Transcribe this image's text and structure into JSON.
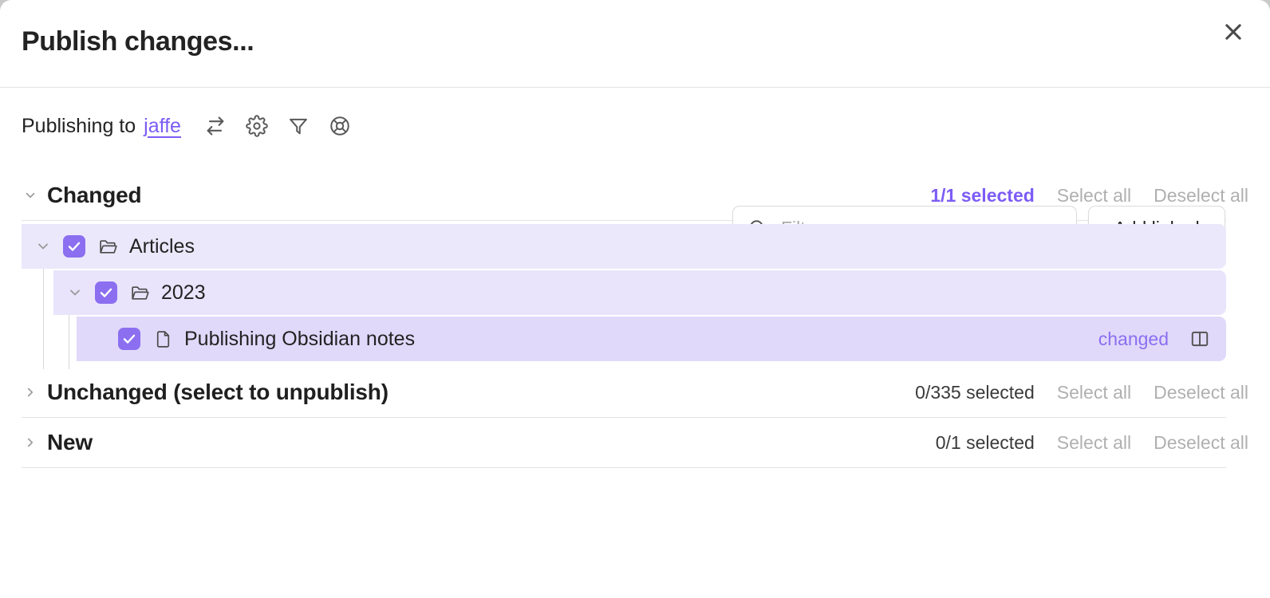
{
  "window": {
    "title": "Publish changes...",
    "close_icon": "close-icon"
  },
  "toolbar": {
    "publishing_label": "Publishing to",
    "target": "jaffe",
    "icons": [
      {
        "name": "swap-arrows-icon",
        "title": "Switch site"
      },
      {
        "name": "gear-icon",
        "title": "Settings"
      },
      {
        "name": "filter-funnel-icon",
        "title": "Filter"
      },
      {
        "name": "lifebuoy-icon",
        "title": "Help"
      }
    ],
    "filter": {
      "icon": "search-icon",
      "placeholder": "Filter...",
      "value": ""
    },
    "add_linked_label": "Add linked"
  },
  "sections": [
    {
      "id": "changed",
      "title": "Changed",
      "expanded": true,
      "chevron": "chevron-down-icon",
      "selected_text": "1/1 selected",
      "selected_highlight": true,
      "select_all_label": "Select all",
      "deselect_all_label": "Deselect all"
    },
    {
      "id": "unchanged",
      "title": "Unchanged (select to unpublish)",
      "expanded": false,
      "chevron": "chevron-right-icon",
      "selected_text": "0/335 selected",
      "selected_highlight": false,
      "select_all_label": "Select all",
      "deselect_all_label": "Deselect all"
    },
    {
      "id": "new",
      "title": "New",
      "expanded": false,
      "chevron": "chevron-right-icon",
      "selected_text": "0/1 selected",
      "selected_highlight": false,
      "select_all_label": "Select all",
      "deselect_all_label": "Deselect all"
    }
  ],
  "tree": [
    {
      "level": 0,
      "kind": "folder",
      "icon": "folder-open-icon",
      "label": "Articles",
      "checked": true,
      "expanded": true,
      "chevron": "chevron-down-icon",
      "status": "",
      "has_diff": false
    },
    {
      "level": 1,
      "kind": "folder",
      "icon": "folder-open-icon",
      "label": "2023",
      "checked": true,
      "expanded": true,
      "chevron": "chevron-down-icon",
      "status": "",
      "has_diff": false
    },
    {
      "level": 2,
      "kind": "file",
      "icon": "file-document-icon",
      "label": "Publishing Obsidian notes",
      "checked": true,
      "expanded": false,
      "chevron": "",
      "status": "changed",
      "has_diff": true,
      "diff_icon": "split-pane-icon"
    }
  ],
  "colors": {
    "accent": "#7c5cf5",
    "checkbox": "#8b6ff0",
    "row_level0": "#ece8fb",
    "row_level1": "#e9e4fb",
    "row_level2": "#e0d9fa",
    "muted_text": "#b0b0b0",
    "divider": "#e3e3e3"
  }
}
